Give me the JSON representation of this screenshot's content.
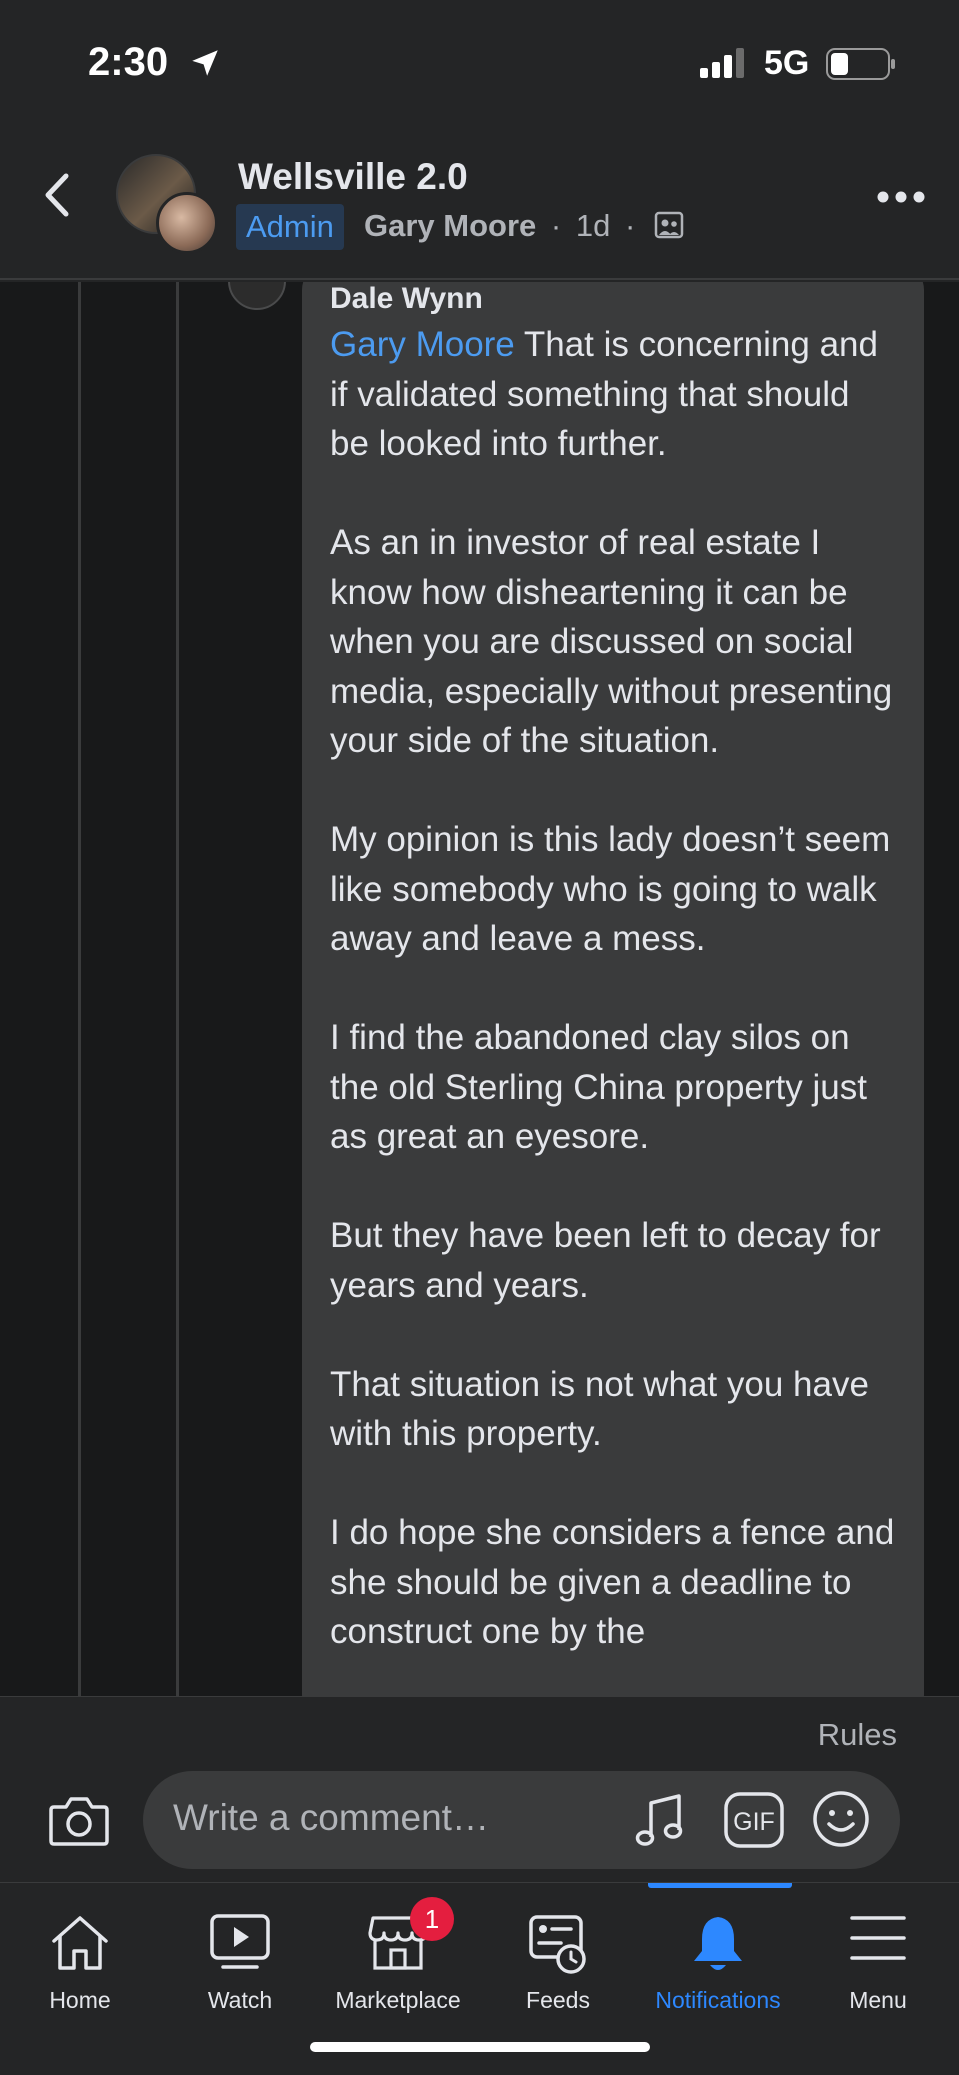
{
  "status_bar": {
    "time": "2:30",
    "network": "5G"
  },
  "header": {
    "group_name": "Wellsville 2.0",
    "role_badge": "Admin",
    "author": "Gary Moore",
    "separator": "·",
    "age": "1d"
  },
  "comment": {
    "author": "Dale Wynn",
    "mention": "Gary Moore",
    "first_text": " That is concerning and if validated something that should be looked into further.",
    "paragraphs": [
      "As an in investor of real estate I know how disheartening it can be when you are discussed on social media, especially without presenting your side of the situation.",
      "My opinion is this lady doesn’t seem like somebody who is going to walk away and leave a mess.",
      "I find the abandoned clay silos on the old Sterling China property just as great an eyesore.",
      "But they have been left to decay for years and years.",
      "That situation is not what you have with this property.",
      "I do hope she considers a fence and she should be given a deadline to construct one by the"
    ]
  },
  "composer": {
    "rules_label": "Rules",
    "placeholder": "Write a comment…"
  },
  "nav": {
    "items": [
      {
        "label": "Home",
        "icon": "home-icon"
      },
      {
        "label": "Watch",
        "icon": "watch-icon"
      },
      {
        "label": "Marketplace",
        "icon": "marketplace-icon",
        "badge": "1"
      },
      {
        "label": "Feeds",
        "icon": "feeds-icon"
      },
      {
        "label": "Notifications",
        "icon": "bell-icon",
        "active": true
      },
      {
        "label": "Menu",
        "icon": "hamburger-icon"
      }
    ]
  },
  "colors": {
    "accent": "#2d88ff",
    "mention": "#4c9bf0",
    "badge": "#e41e3f",
    "background": "#18191a",
    "surface": "#242526",
    "bubble": "#3a3b3c"
  }
}
